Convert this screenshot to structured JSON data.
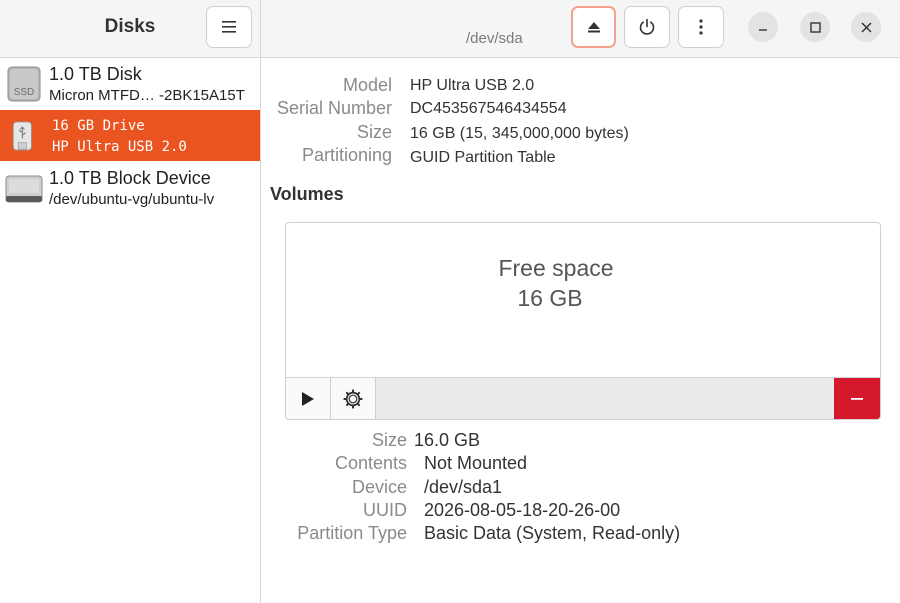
{
  "sidebar": {
    "title": "Disks",
    "menu_icon": "hamburger-menu-icon",
    "disks": [
      {
        "name": "1.0 TB Disk",
        "subtitle": "Micron MTFD… -2BK15A15T",
        "icon": "ssd-icon",
        "icon_text": "SSD"
      },
      {
        "name": "16 GB Drive",
        "subtitle": "HP Ultra USB 2.0",
        "icon": "usb-drive-icon",
        "selected": true
      },
      {
        "name": "1.0 TB Block Device",
        "subtitle": "/dev/ubuntu-vg/ubuntu-lv",
        "icon": "block-device-icon"
      }
    ]
  },
  "header": {
    "device_path": "/dev/sda",
    "buttons": [
      "eject-icon",
      "power-icon",
      "more-options-icon"
    ],
    "window_controls": [
      "minimize-icon",
      "maximize-icon",
      "close-icon"
    ]
  },
  "drive_info": {
    "model_label": "Model",
    "model_value": "HP Ultra USB 2.0",
    "serial_label": "Serial Number",
    "serial_value": "DC453567546434554",
    "size_label": "Size",
    "size_value": "16 GB (15, 345,000,000 bytes)",
    "partitioning_label": "Partitioning",
    "partitioning_value": "GUID Partition Table"
  },
  "volumes": {
    "title": "Volumes",
    "free_space_line1": "Free space",
    "free_space_line2": "16 GB"
  },
  "partition_info": {
    "size_label": "Size",
    "size_value": "16.0 GB",
    "contents_label": "Contents",
    "contents_value": "Not Mounted",
    "device_label": "Device",
    "device_value": "/dev/sda1",
    "uuid_label": "UUID",
    "uuid_value": "2026-08-05-18-20-26-00",
    "partition_type_label": "Partition Type",
    "partition_type_value": "Basic Data (System, Read-only)"
  },
  "colors": {
    "accent": "#e95420",
    "delete": "#d6182d",
    "eject_border": "#f0a28a"
  }
}
